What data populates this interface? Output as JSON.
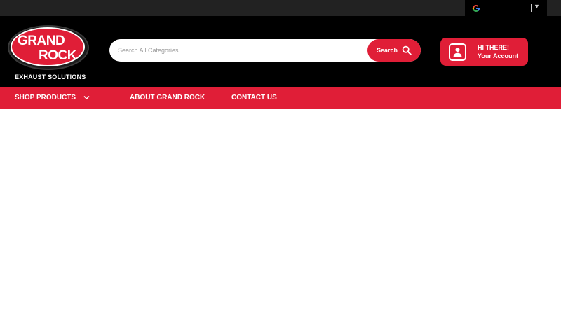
{
  "translate_widget": {
    "icon": "google-g-icon",
    "arrow": "▼"
  },
  "logo": {
    "line1": "GRAND",
    "line2": "ROCK",
    "tagline": "EXHAUST SOLUTIONS"
  },
  "search": {
    "placeholder": "Search All Categories",
    "button_label": "Search",
    "icon": "search-icon"
  },
  "account": {
    "greeting": "HI THERE!",
    "label": "Your Account",
    "icon": "user-icon"
  },
  "nav": {
    "items": [
      {
        "label": "SHOP PRODUCTS",
        "icon": "chevron-down-icon"
      },
      {
        "label": "ABOUT GRAND ROCK"
      },
      {
        "label": "CONTACT US"
      }
    ]
  },
  "colors": {
    "brand_red": "#e01e37",
    "header_bg": "#000000",
    "topbar_bg": "#222222"
  }
}
